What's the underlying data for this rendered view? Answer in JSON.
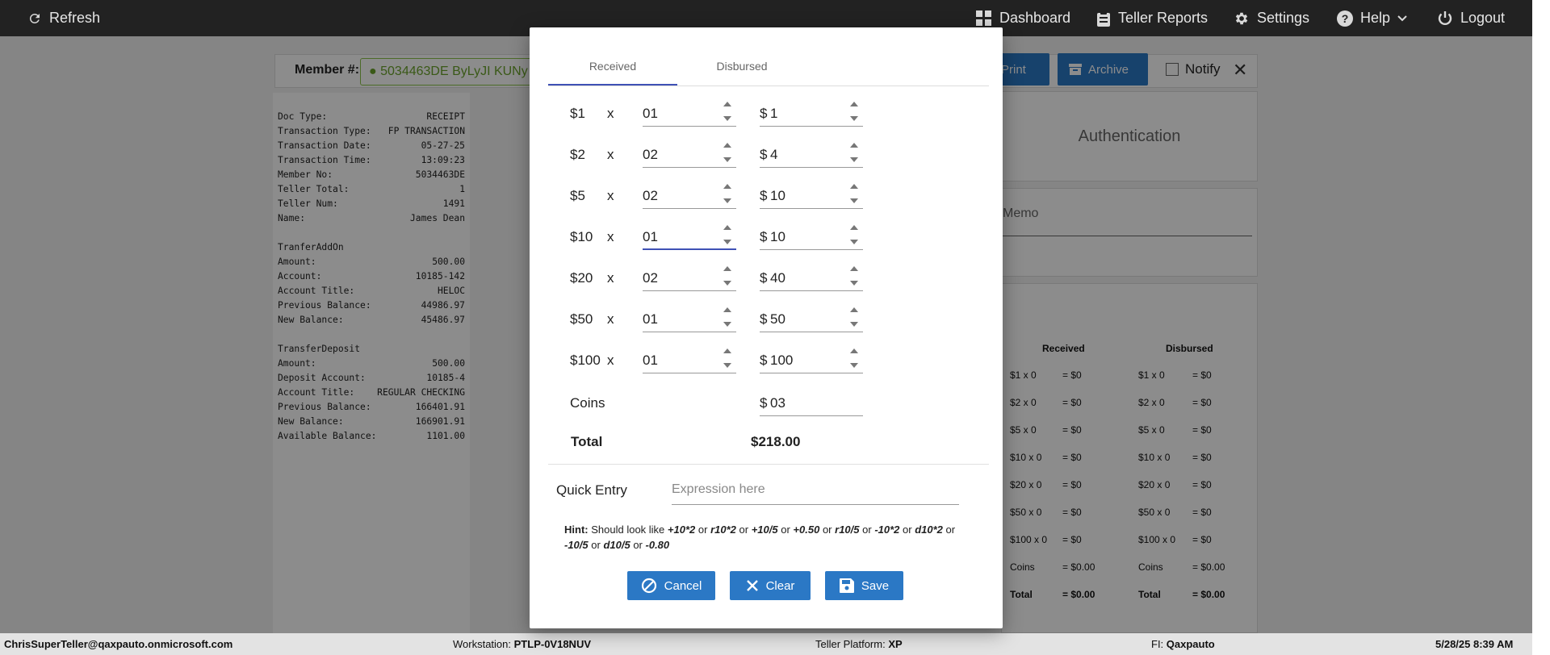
{
  "topbar": {
    "refresh": "Refresh",
    "dashboard": "Dashboard",
    "teller_reports": "Teller Reports",
    "settings": "Settings",
    "help": "Help",
    "logout": "Logout"
  },
  "member": {
    "label": "Member #:",
    "value": "5034463DE ByLyJI KUNy"
  },
  "toolbar": {
    "print": "Print",
    "archive": "Archive",
    "notify": "Notify"
  },
  "receipt": {
    "header": [
      {
        "label": "Doc Type:",
        "value": "RECEIPT"
      },
      {
        "label": "Transaction Type:",
        "value": "FP TRANSACTION"
      },
      {
        "label": "Transaction Date:",
        "value": "05-27-25"
      },
      {
        "label": "Transaction Time:",
        "value": "13:09:23"
      },
      {
        "label": "Member No:",
        "value": "5034463DE"
      },
      {
        "label": "Teller Total:",
        "value": "1"
      },
      {
        "label": "Teller Num:",
        "value": "1491"
      },
      {
        "label": "Name:",
        "value": "James Dean"
      }
    ],
    "section1_title": "TranferAddOn",
    "section1": [
      {
        "label": "Amount:",
        "value": "500.00"
      },
      {
        "label": "Account:",
        "value": "10185-142"
      },
      {
        "label": "Account Title:",
        "value": "HELOC"
      },
      {
        "label": "Previous Balance:",
        "value": "44986.97"
      },
      {
        "label": "New Balance:",
        "value": "45486.97"
      }
    ],
    "section2_title": "TransferDeposit",
    "section2": [
      {
        "label": "Amount:",
        "value": "500.00"
      },
      {
        "label": "Deposit Account:",
        "value": "10185-4"
      },
      {
        "label": "Account Title:",
        "value": "REGULAR CHECKING"
      },
      {
        "label": "Previous Balance:",
        "value": "166401.91"
      },
      {
        "label": "New Balance:",
        "value": "166901.91"
      },
      {
        "label": "Available Balance:",
        "value": "1101.00"
      }
    ]
  },
  "auth_panel": {
    "title": "Authentication"
  },
  "memo_panel": {
    "label": "Memo"
  },
  "cash_summary": {
    "received_header": "Received",
    "disbursed_header": "Disbursed",
    "rows": [
      {
        "r_label": "$1 x 0",
        "r_value": "= $0",
        "d_label": "$1 x 0",
        "d_value": "= $0"
      },
      {
        "r_label": "$2 x 0",
        "r_value": "= $0",
        "d_label": "$2 x 0",
        "d_value": "= $0"
      },
      {
        "r_label": "$5 x 0",
        "r_value": "= $0",
        "d_label": "$5 x 0",
        "d_value": "= $0"
      },
      {
        "r_label": "$10 x 0",
        "r_value": "= $0",
        "d_label": "$10 x 0",
        "d_value": "= $0"
      },
      {
        "r_label": "$20 x 0",
        "r_value": "= $0",
        "d_label": "$20 x 0",
        "d_value": "= $0"
      },
      {
        "r_label": "$50 x 0",
        "r_value": "= $0",
        "d_label": "$50 x 0",
        "d_value": "= $0"
      },
      {
        "r_label": "$100 x 0",
        "r_value": "= $0",
        "d_label": "$100 x 0",
        "d_value": "= $0"
      },
      {
        "r_label": "Coins",
        "r_value": "= $0.00",
        "d_label": "Coins",
        "d_value": "= $0.00"
      },
      {
        "r_label": "Total",
        "r_value": "= $0.00",
        "d_label": "Total",
        "d_value": "= $0.00"
      }
    ]
  },
  "status": {
    "user": "ChrisSuperTeller@qaxpauto.onmicrosoft.com",
    "workstation_label": "Workstation:",
    "workstation": "PTLP-0V18NUV",
    "platform_label": "Teller Platform:",
    "platform": "XP",
    "fi_label": "FI:",
    "fi": "Qaxpauto",
    "datetime": "5/28/25 8:39 AM"
  },
  "modal": {
    "tabs": [
      "Received",
      "Disbursed"
    ],
    "active_tab": "Received",
    "times": "x",
    "currency": "$",
    "rows": [
      {
        "denomination": "$1",
        "quantity": "01",
        "amount": "1"
      },
      {
        "denomination": "$2",
        "quantity": "02",
        "amount": "4"
      },
      {
        "denomination": "$5",
        "quantity": "02",
        "amount": "10"
      },
      {
        "denomination": "$10",
        "quantity": "01",
        "amount": "10"
      },
      {
        "denomination": "$20",
        "quantity": "02",
        "amount": "40"
      },
      {
        "denomination": "$50",
        "quantity": "01",
        "amount": "50"
      },
      {
        "denomination": "$100",
        "quantity": "01",
        "amount": "100"
      }
    ],
    "coins_label": "Coins",
    "coins_value": "03",
    "total_label": "Total",
    "total_value": "$218.00",
    "quick_entry_label": "Quick Entry",
    "quick_entry_placeholder": "Expression here",
    "hint_label": "Hint:",
    "hint_text": "Should look like",
    "hint_examples": [
      "+10*2",
      "r10*2",
      "+10/5",
      "+0.50",
      "r10/5",
      "-10*2",
      "d10*2",
      "-10/5",
      "d10/5",
      "-0.80"
    ],
    "hint_separator": "or",
    "cancel": "Cancel",
    "clear": "Clear",
    "save": "Save"
  }
}
